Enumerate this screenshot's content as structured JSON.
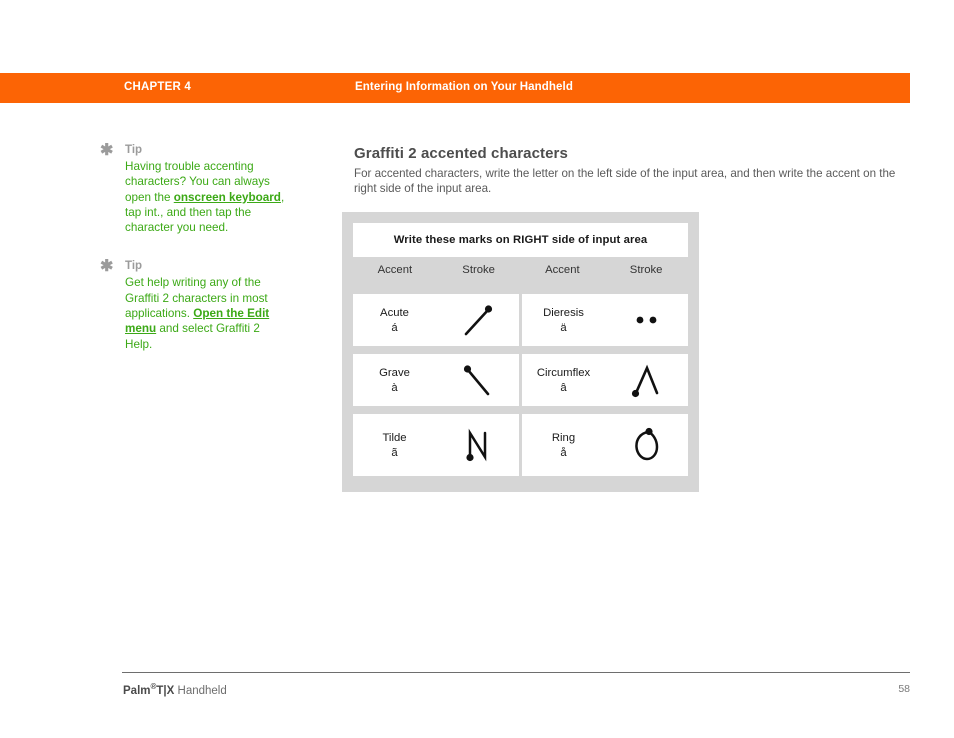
{
  "header": {
    "chapter": "CHAPTER 4",
    "title": "Entering Information on Your Handheld",
    "bar_color": "#FC6405"
  },
  "tips": [
    {
      "icon": "asterisk-icon",
      "label": "Tip",
      "text_parts": [
        {
          "text": "Having trouble accenting characters? You can always open the ",
          "style": "plain"
        },
        {
          "text": "onscreen keyboard",
          "style": "link"
        },
        {
          "text": ", tap int., and then tap the character you need.",
          "style": "plain"
        }
      ],
      "full_text": "Having trouble accenting characters? You can always open the onscreen keyboard, tap int., and then tap the character you need."
    },
    {
      "icon": "asterisk-icon",
      "label": "Tip",
      "text_parts": [
        {
          "text": "Get help writing any of the Graffiti 2 characters in most applications. ",
          "style": "plain"
        },
        {
          "text": "Open the Edit menu",
          "style": "link"
        },
        {
          "text": " and select Graffiti 2 Help.",
          "style": "plain"
        }
      ],
      "full_text": "Get help writing any of the Graffiti 2 characters in most applications. Open the Edit menu and select Graffiti 2 Help."
    }
  ],
  "main": {
    "heading": "Graffiti 2 accented characters",
    "intro": "For accented characters, write the letter on the left side of the input area, and then write the accent on the right side of the input area."
  },
  "figure": {
    "banner": "Write these marks on RIGHT side of input area",
    "column_headers": [
      "Accent",
      "Stroke",
      "Accent",
      "Stroke"
    ],
    "rows": [
      [
        {
          "accent_name": "Acute",
          "accent_sample": "á",
          "stroke_icon": "acute-stroke-icon"
        },
        {
          "accent_name": "Dieresis",
          "accent_sample": "ä",
          "stroke_icon": "dieresis-stroke-icon"
        }
      ],
      [
        {
          "accent_name": "Grave",
          "accent_sample": "à",
          "stroke_icon": "grave-stroke-icon"
        },
        {
          "accent_name": "Circumflex",
          "accent_sample": "â",
          "stroke_icon": "circumflex-stroke-icon"
        }
      ],
      [
        {
          "accent_name": "Tilde",
          "accent_sample": "ã",
          "stroke_icon": "tilde-stroke-icon"
        },
        {
          "accent_name": "Ring",
          "accent_sample": "å",
          "stroke_icon": "ring-stroke-icon"
        }
      ]
    ]
  },
  "footer": {
    "product_bold": "Palm",
    "product_reg": "®",
    "product_model": "T|X",
    "product_rest": " Handheld",
    "page_number": "58"
  }
}
